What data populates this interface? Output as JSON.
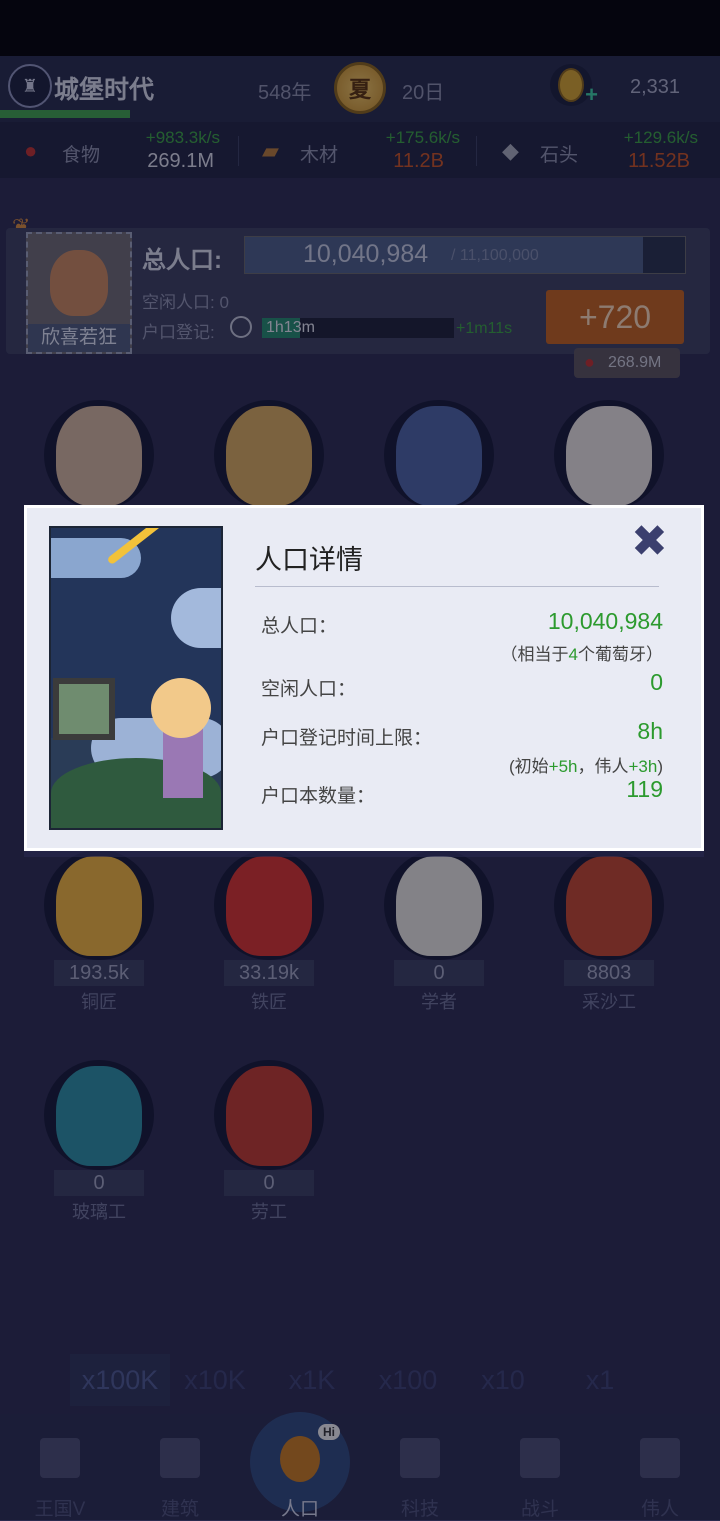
{
  "header": {
    "game_title": "城堡时代",
    "year": "548年",
    "season": "夏",
    "day": "20日",
    "gold": "2,331"
  },
  "resources": [
    {
      "icon": "apple-icon",
      "name": "食物",
      "rate": "+983.3k/s",
      "amount": "269.1M",
      "amount_color": "#d9dbe6"
    },
    {
      "icon": "wood-icon",
      "name": "木材",
      "rate": "+175.6k/s",
      "amount": "11.2B",
      "amount_color": "#c9531f"
    },
    {
      "icon": "stone-icon",
      "name": "石头",
      "rate": "+129.6k/s",
      "amount": "11.52B",
      "amount_color": "#c9531f"
    }
  ],
  "population_panel": {
    "mood": "欣喜若狂",
    "label": "总人口:",
    "current": "10,040,984",
    "max": "/ 11,100,000",
    "fill_fraction": 0.905,
    "idle": "空闲人口: 0",
    "registration_label": "户口登记:",
    "registration_timer": "1h13m",
    "registration_fill_fraction": 0.2,
    "registration_increment": "+1m11s",
    "add_button": "+720",
    "add_cost": "268.9M"
  },
  "heroes": [
    {
      "count": "193.5k",
      "name": "铜匠",
      "color": "#f0b53a"
    },
    {
      "count": "33.19k",
      "name": "铁匠",
      "color": "#d7322a"
    },
    {
      "count": "0",
      "name": "学者",
      "color": "#e6e4dc"
    },
    {
      "count": "8803",
      "name": "采沙工",
      "color": "#c2452a"
    },
    {
      "count": "0",
      "name": "玻璃工",
      "color": "#2a8fa0"
    },
    {
      "count": "0",
      "name": "劳工",
      "color": "#c0392b"
    }
  ],
  "dialog": {
    "title": "人口详情",
    "total_label": "总人口：",
    "total_value": "10,040,984",
    "total_note_pre": "（相当于",
    "total_note_num": "4",
    "total_note_post": "个葡萄牙）",
    "idle_label": "空闲人口：",
    "idle_value": "0",
    "limit_label": "户口登记时间上限：",
    "limit_value": "8h",
    "limit_note_pre": "(初始",
    "limit_note_a": "+5h",
    "limit_note_mid": "，伟人",
    "limit_note_b": "+3h",
    "limit_note_post": ")",
    "book_label": "户口本数量：",
    "book_value": "119"
  },
  "multipliers": [
    "x100K",
    "x10K",
    "x1K",
    "x100",
    "x10",
    "x1"
  ],
  "selected_multiplier": "x100K",
  "nav": [
    {
      "label": "王国V",
      "icon": "castle-icon"
    },
    {
      "label": "建筑",
      "icon": "house-icon"
    },
    {
      "label": "人口",
      "icon": "people-icon",
      "badge": "Hi"
    },
    {
      "label": "科技",
      "icon": "book-icon"
    },
    {
      "label": "战斗",
      "icon": "swords-icon"
    },
    {
      "label": "伟人",
      "icon": "statue-icon"
    }
  ]
}
